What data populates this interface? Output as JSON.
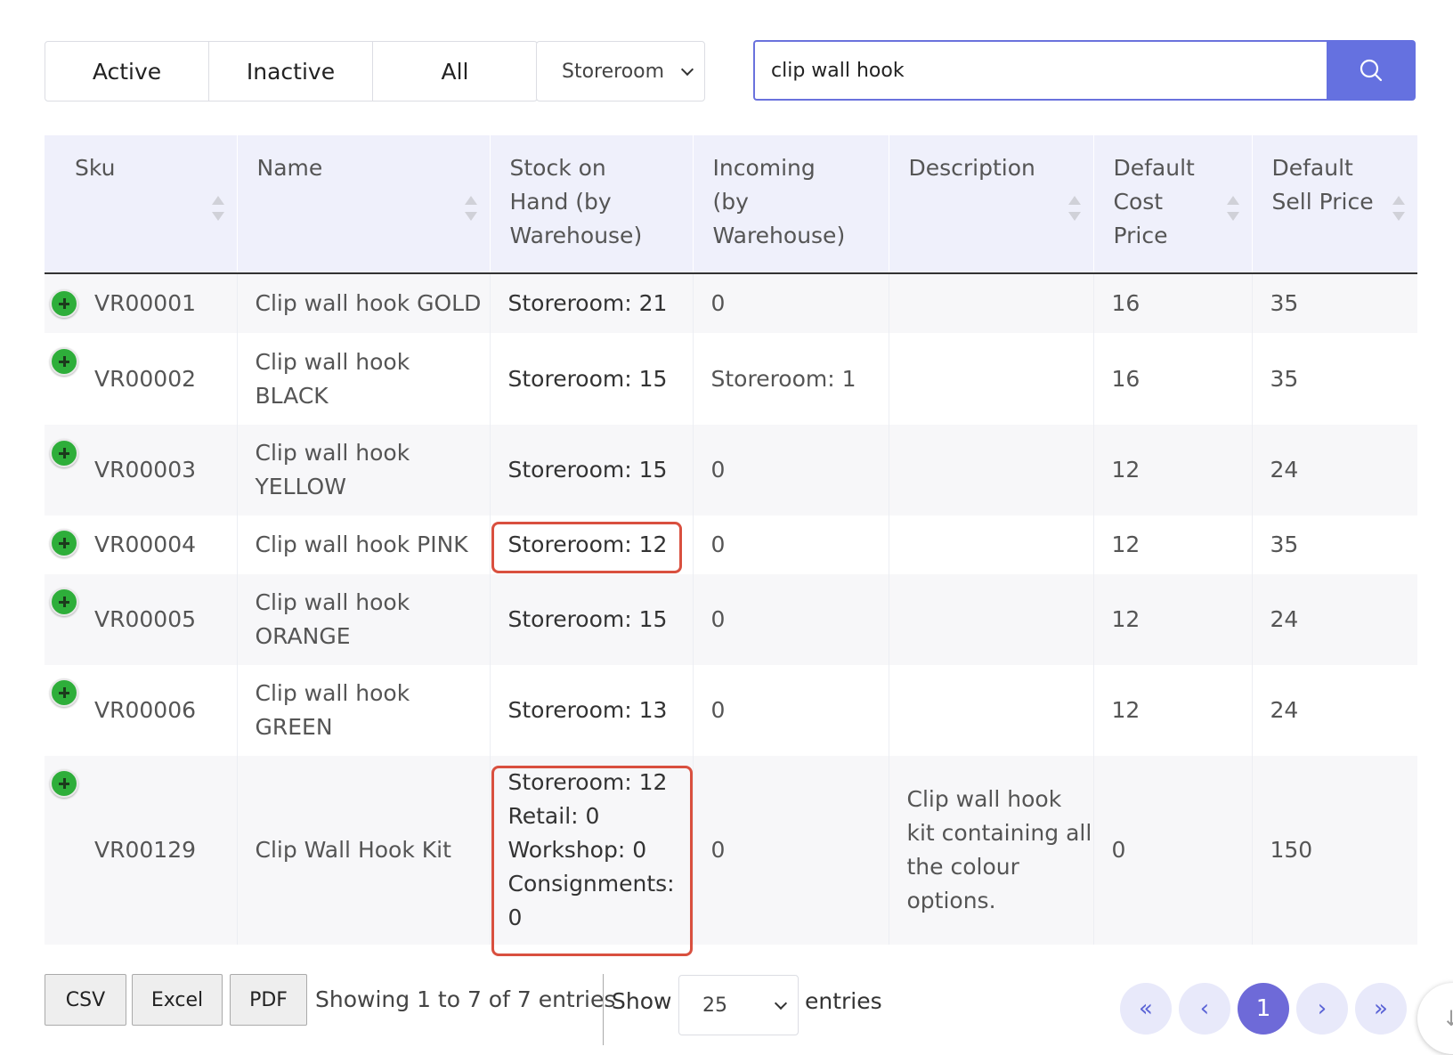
{
  "filters": {
    "active": "Active",
    "inactive": "Inactive",
    "all": "All",
    "warehouse_select": "Storeroom"
  },
  "search": {
    "value": "clip wall hook",
    "icon": "search-icon"
  },
  "table": {
    "headers": {
      "sku": "Sku",
      "name": "Name",
      "stock": "Stock on Hand (by Warehouse)",
      "incoming": "Incoming (by Warehouse)",
      "description": "Description",
      "cost": "Default Cost Price",
      "sell": "Default Sell Price"
    },
    "rows": [
      {
        "sku": "VR00001",
        "name": "Clip wall hook GOLD",
        "stock": "Storeroom: 21",
        "incoming": "0",
        "description": "",
        "cost": "16",
        "sell": "35"
      },
      {
        "sku": "VR00002",
        "name": "Clip wall hook BLACK",
        "stock": "Storeroom: 15",
        "incoming": "Storeroom: 1",
        "description": "",
        "cost": "16",
        "sell": "35"
      },
      {
        "sku": "VR00003",
        "name": "Clip wall hook YELLOW",
        "stock": "Storeroom: 15",
        "incoming": "0",
        "description": "",
        "cost": "12",
        "sell": "24"
      },
      {
        "sku": "VR00004",
        "name": "Clip wall hook PINK",
        "stock": "Storeroom: 12",
        "incoming": "0",
        "description": "",
        "cost": "12",
        "sell": "35"
      },
      {
        "sku": "VR00005",
        "name": "Clip wall hook ORANGE",
        "stock": "Storeroom: 15",
        "incoming": "0",
        "description": "",
        "cost": "12",
        "sell": "24"
      },
      {
        "sku": "VR00006",
        "name": "Clip wall hook GREEN",
        "stock": "Storeroom: 13",
        "incoming": "0",
        "description": "",
        "cost": "12",
        "sell": "24"
      },
      {
        "sku": "VR00129",
        "name": "Clip Wall Hook Kit",
        "stock": "Storeroom: 12 Retail: 0 Workshop: 0 Consignments: 0",
        "incoming": "0",
        "description": "Clip wall hook kit containing all the colour options.",
        "cost": "0",
        "sell": "150"
      }
    ],
    "row_icon": "add-circle-icon"
  },
  "footer": {
    "csv": "CSV",
    "excel": "Excel",
    "pdf": "PDF",
    "info": "Showing 1 to 7 of 7 entries",
    "show": "Show",
    "page_length": "25",
    "entries": "entries",
    "pagination": {
      "first": "«",
      "prev": "‹",
      "current": "1",
      "next": "›",
      "last": "»"
    }
  },
  "colors": {
    "accent": "#6571e0",
    "add_icon": "#2eae3a",
    "highlight": "#d9503f",
    "header_bg": "#eff0fb"
  }
}
